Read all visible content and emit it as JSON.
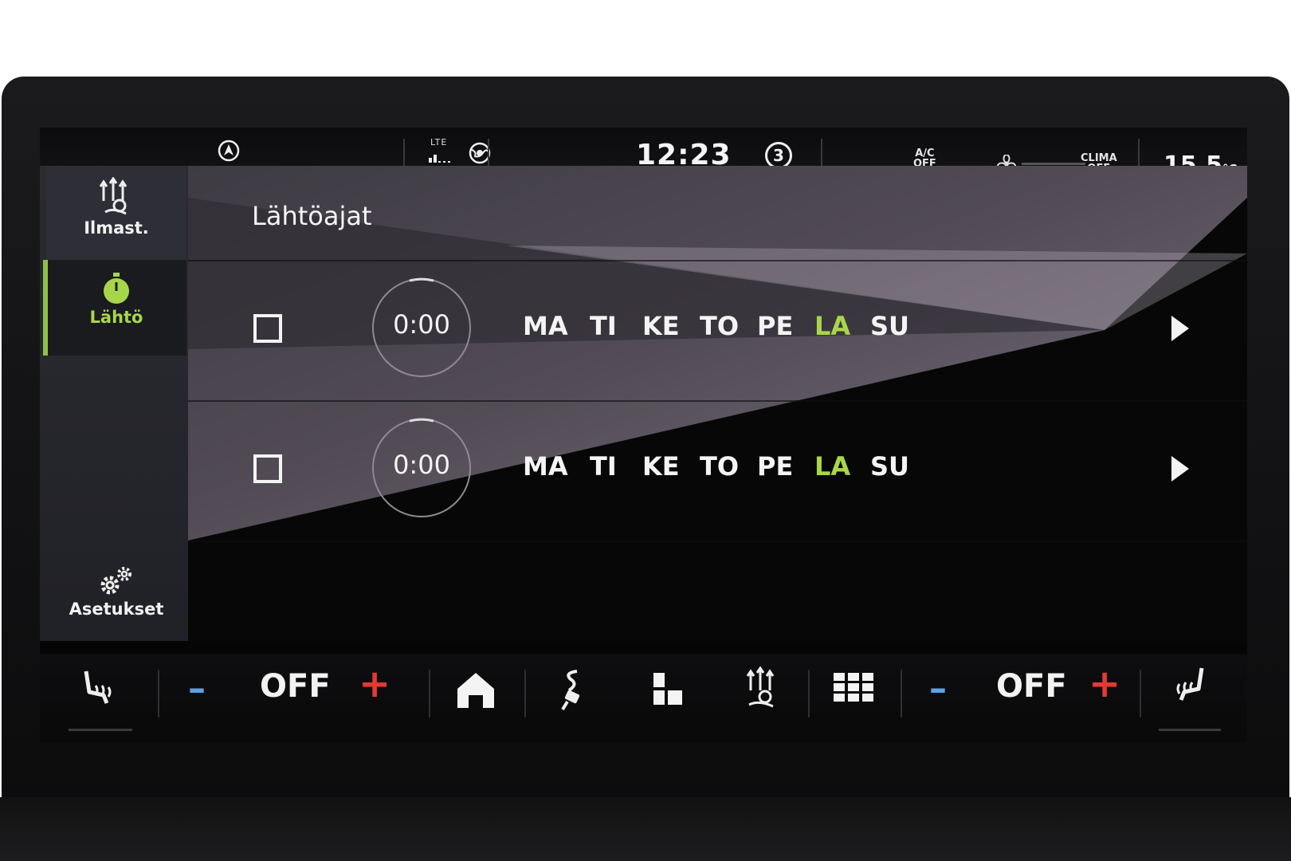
{
  "status_bar": {
    "network": "LTE",
    "time": "12:23",
    "badge": "3",
    "ac_status": [
      "A/C",
      "OFF"
    ],
    "clima_status": [
      "CLIMA",
      "OFF"
    ],
    "temperature": "15.5",
    "temperature_unit": "°C"
  },
  "sidebar": {
    "items": [
      {
        "label": "Ilmast.",
        "icon": "climate-icon"
      },
      {
        "label": "Lähtö",
        "icon": "timer-icon",
        "active": true
      },
      {
        "label": "Asetukset",
        "icon": "gear-icon"
      }
    ]
  },
  "main": {
    "title": "Lähtöajat",
    "rows": [
      {
        "time": "0:00",
        "checked": false,
        "days": [
          "MA",
          "TI",
          "KE",
          "TO",
          "PE",
          "LA",
          "SU"
        ],
        "highlighted_day": "LA"
      },
      {
        "time": "0:00",
        "checked": false,
        "days": [
          "MA",
          "TI",
          "KE",
          "TO",
          "PE",
          "LA",
          "SU"
        ],
        "highlighted_day": "LA"
      }
    ]
  },
  "bottom_bar": {
    "left_fan_value": "OFF",
    "right_fan_value": "OFF",
    "minus_symbol": "–",
    "plus_symbol": "+"
  },
  "colors": {
    "accent_green": "#a8d64b",
    "minus_blue": "#5aa3e8",
    "plus_red": "#e53935"
  }
}
